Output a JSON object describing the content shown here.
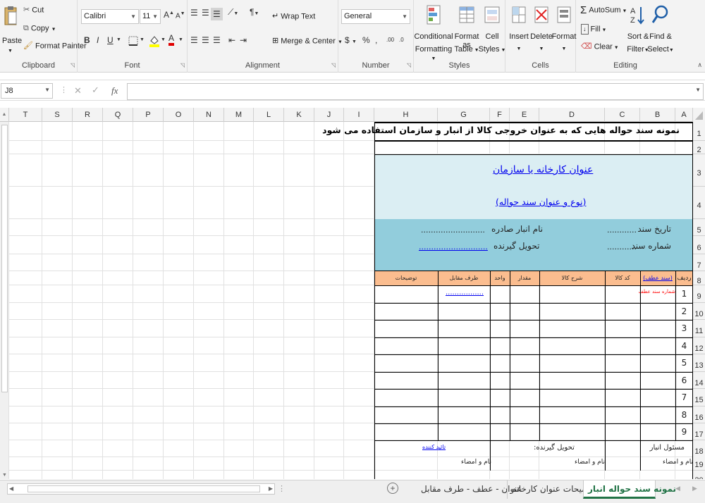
{
  "ribbon": {
    "clipboard": {
      "paste": "Paste",
      "cut": "Cut",
      "copy": "Copy",
      "format_painter": "Format Painter",
      "label": "Clipboard"
    },
    "font": {
      "name": "Calibri",
      "size": "11",
      "label": "Font"
    },
    "alignment": {
      "wrap_text": "Wrap Text",
      "merge_center": "Merge & Center",
      "label": "Alignment"
    },
    "number": {
      "format": "General",
      "label": "Number"
    },
    "styles": {
      "cond1": "Conditional",
      "cond2": "Formatting",
      "fmt1": "Format as",
      "fmt2": "Table",
      "cell1": "Cell",
      "cell2": "Styles",
      "label": "Styles"
    },
    "cells": {
      "insert": "Insert",
      "delete": "Delete",
      "format": "Format",
      "label": "Cells"
    },
    "editing": {
      "autosum": "AutoSum",
      "fill": "Fill",
      "clear": "Clear",
      "sort1": "Sort &",
      "sort2": "Filter",
      "find1": "Find &",
      "find2": "Select",
      "label": "Editing"
    }
  },
  "formula_bar": {
    "cell_ref": "J8",
    "fx": "fx",
    "content": ""
  },
  "columns": [
    "T",
    "S",
    "R",
    "Q",
    "P",
    "O",
    "N",
    "M",
    "L",
    "K",
    "J",
    "I",
    "H",
    "G",
    "F",
    "E",
    "D",
    "C",
    "B",
    "A"
  ],
  "rows": [
    "1",
    "2",
    "3",
    "4",
    "5",
    "6",
    "7",
    "8",
    "9",
    "10",
    "11",
    "12",
    "13",
    "14",
    "15",
    "16",
    "17",
    "18",
    "19",
    "20"
  ],
  "form": {
    "title": "نمونه سند حواله هایی که به عنوان خروجی کالا از انبار و  سازمان استفاده می شود",
    "company": "عنوان کارخانه یا سازمان",
    "doc_type": "(نوع و عنوان سند حواله)",
    "date": "تاریخ سند",
    "date_dots": "............",
    "number": "شماره سند",
    "number_dots": "............",
    "warehouse": "نام  انبار صادره",
    "warehouse_dots": "..........................",
    "receiver": "تحویل گیرنده",
    "receiver_dots": "............................",
    "headers": [
      "ردیف",
      "(سند عطف)",
      "کد کالا",
      "شرح کالا",
      "مقدار",
      "واحد",
      "طرف مقابل",
      "توضیحات"
    ],
    "row_numbers": [
      "1",
      "2",
      "3",
      "4",
      "5",
      "6",
      "7",
      "8",
      "9"
    ],
    "ref_number": "شماره سند عطف",
    "counterpart_dots": ".................",
    "warehouse_manager": "مسئول انبار",
    "receiver_footer": "تحویل گیرنده:",
    "approver": "تائید کننده",
    "sign1": "نام و امضاء",
    "sign2": "نام و امضاء",
    "sign3": "نام و امضاء"
  },
  "sheet_tabs": [
    "نمونه سند حواله انبار",
    "توضیحات عنوان کارخانه",
    "عنوان - عطف - طرف مقابل"
  ],
  "add_sheet": "+",
  "colors": {
    "title_blue": "#dbeef3",
    "info_blue": "#92cddc",
    "header_orange": "#fbbd8f",
    "link_blue": "#0000ee",
    "ref_red": "#ff0000",
    "active_tab_green": "#217346"
  }
}
